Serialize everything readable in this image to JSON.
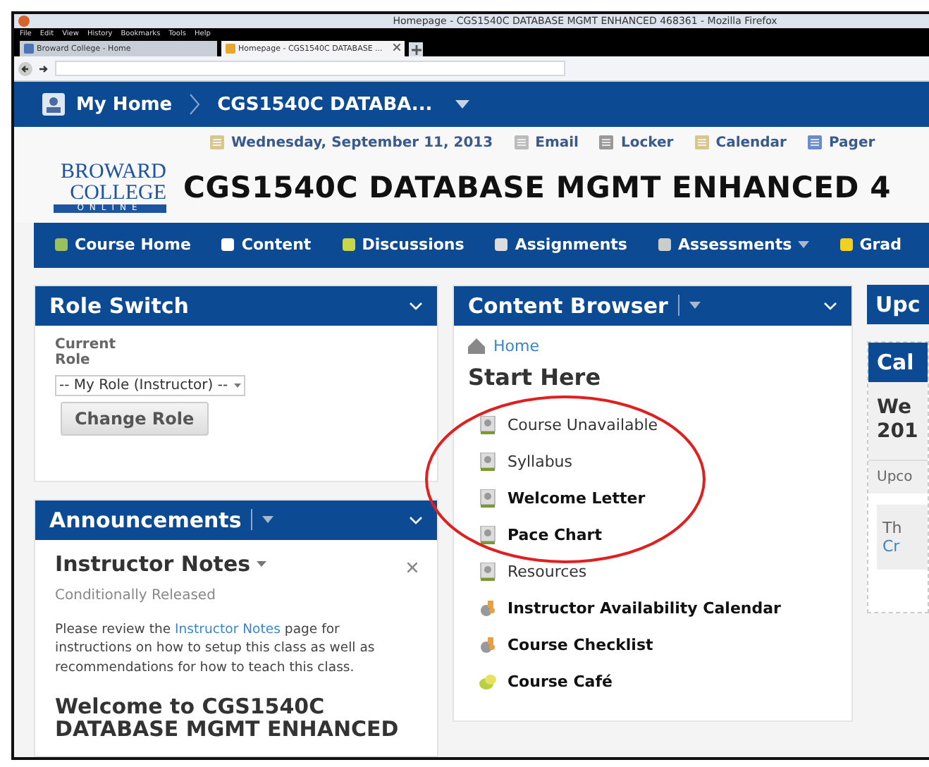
{
  "window": {
    "title": "Homepage - CGS1540C DATABASE MGMT ENHANCED 468361 - Mozilla Firefox"
  },
  "menu": [
    "File",
    "Edit",
    "View",
    "History",
    "Bookmarks",
    "Tools",
    "Help"
  ],
  "tabs": [
    {
      "label": "Broward College - Home",
      "selected": false
    },
    {
      "label": "Homepage - CGS1540C DATABASE ...",
      "selected": true
    }
  ],
  "navbar": {
    "home": "My Home",
    "course": "CGS1540C DATABA..."
  },
  "utility_links": [
    "Wednesday, September 11, 2013",
    "Email",
    "Locker",
    "Calendar",
    "Pager"
  ],
  "logo": {
    "line1": "BROWARD",
    "line2": "COLLEGE",
    "line3": "ONLINE"
  },
  "course_title": "CGS1540C DATABASE MGMT ENHANCED 4",
  "course_nav": [
    {
      "label": "Course Home",
      "menu": false
    },
    {
      "label": "Content",
      "menu": false
    },
    {
      "label": "Discussions",
      "menu": false
    },
    {
      "label": "Assignments",
      "menu": false
    },
    {
      "label": "Assessments",
      "menu": true
    },
    {
      "label": "Grad",
      "menu": false
    }
  ],
  "role_switch": {
    "title": "Role Switch",
    "label": "Current Role",
    "value": "-- My Role (Instructor) --",
    "button": "Change Role"
  },
  "announcements": {
    "title": "Announcements",
    "item_title": "Instructor Notes",
    "status": "Conditionally Released",
    "body_before": "Please review the",
    "body_link": "Instructor Notes",
    "body_after": "page for instructions on how to setup this class as well as recommendations for how to teach this class.",
    "next_title": "Welcome to CGS1540C DATABASE MGMT ENHANCED"
  },
  "content_browser": {
    "title": "Content Browser",
    "home": "Home",
    "section": "Start Here",
    "items": [
      {
        "label": "Course Unavailable",
        "kind": "file",
        "unread": false
      },
      {
        "label": "Syllabus",
        "kind": "file",
        "unread": false
      },
      {
        "label": "Welcome Letter",
        "kind": "file",
        "unread": true
      },
      {
        "label": "Pace Chart",
        "kind": "file",
        "unread": true
      },
      {
        "label": "Resources",
        "kind": "file",
        "unread": false
      },
      {
        "label": "Instructor Availability Calendar",
        "kind": "tool",
        "unread": true
      },
      {
        "label": "Course Checklist",
        "kind": "tool",
        "unread": true
      },
      {
        "label": "Course Café",
        "kind": "discussion",
        "unread": true
      }
    ]
  },
  "right_column": {
    "widget_1": "Upc",
    "widget_2": "Cal",
    "date_1": "We",
    "date_2": "201",
    "upcoming": "Upco",
    "note": "Th",
    "link": "Cr"
  }
}
